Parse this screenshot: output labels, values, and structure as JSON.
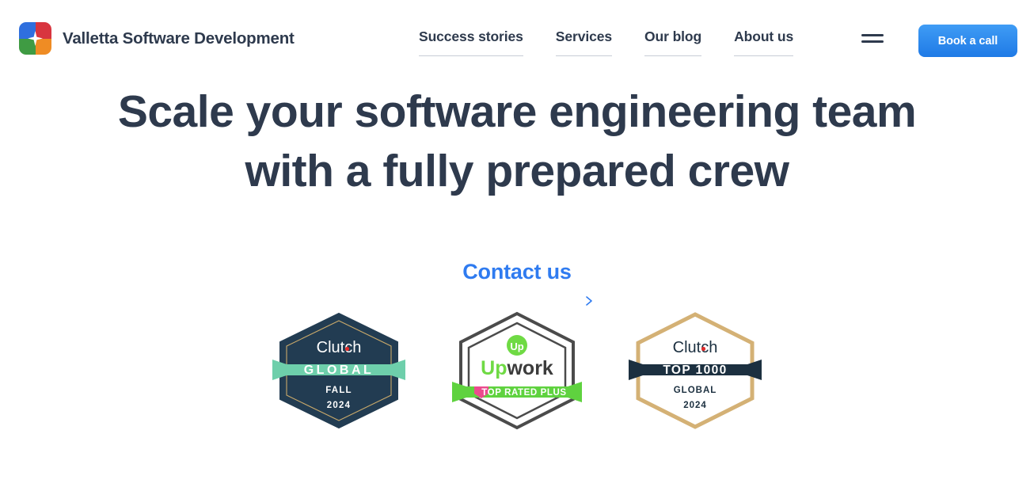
{
  "brand": {
    "name": "Valletta Software Development",
    "logo_icon": "valletta-four-square-logo",
    "logo_colors": {
      "top_left": "#2f6fde",
      "top_right": "#d8353f",
      "bottom_left": "#3f9b43",
      "bottom_right": "#ef8c24"
    }
  },
  "nav": {
    "items": [
      {
        "label": "Success stories"
      },
      {
        "label": "Services"
      },
      {
        "label": "Our blog"
      },
      {
        "label": "About us"
      }
    ],
    "menu_icon": "hamburger-menu-icon"
  },
  "header": {
    "cta_label": "Book a call",
    "cta_color": "#2f7bf0"
  },
  "hero": {
    "title_line1": "Scale your software engineering team",
    "title_line2": "with a fully prepared crew",
    "title_color": "#2e3a4d"
  },
  "contact": {
    "label": "Contact us",
    "color": "#2f7bf0",
    "arrow_icon": "arrow-right-icon"
  },
  "badges": [
    {
      "id": "clutch-global-fall-2024",
      "brand": "Clutch",
      "ribbon": "GLOBAL",
      "line1": "FALL",
      "line2": "2024",
      "body_color": "#223c52",
      "border_color": "#c9a96a",
      "ribbon_color": "#6ecfab",
      "text_color": "#ffffff",
      "accent_dot_color": "#e02b2b"
    },
    {
      "id": "upwork-top-rated-plus",
      "brand_prefix": "Up",
      "brand_suffix": "work",
      "mark": "Up",
      "ribbon": "TOP RATED PLUS",
      "body_color": "#ffffff",
      "border_color": "#4b4b4b",
      "ribbon_color": "#5fd23f",
      "brand_green": "#6fda44",
      "brand_dark": "#3c3c3c",
      "shield_color": "#eb4b8e"
    },
    {
      "id": "clutch-top-1000-global-2024",
      "brand": "Clutch",
      "ribbon": "TOP 1000",
      "line1": "GLOBAL",
      "line2": "2024",
      "body_color": "#ffffff",
      "border_color": "#d4b175",
      "ribbon_color": "#1c3040",
      "text_color": "#1c3040",
      "accent_dot_color": "#e02b2b"
    }
  ]
}
